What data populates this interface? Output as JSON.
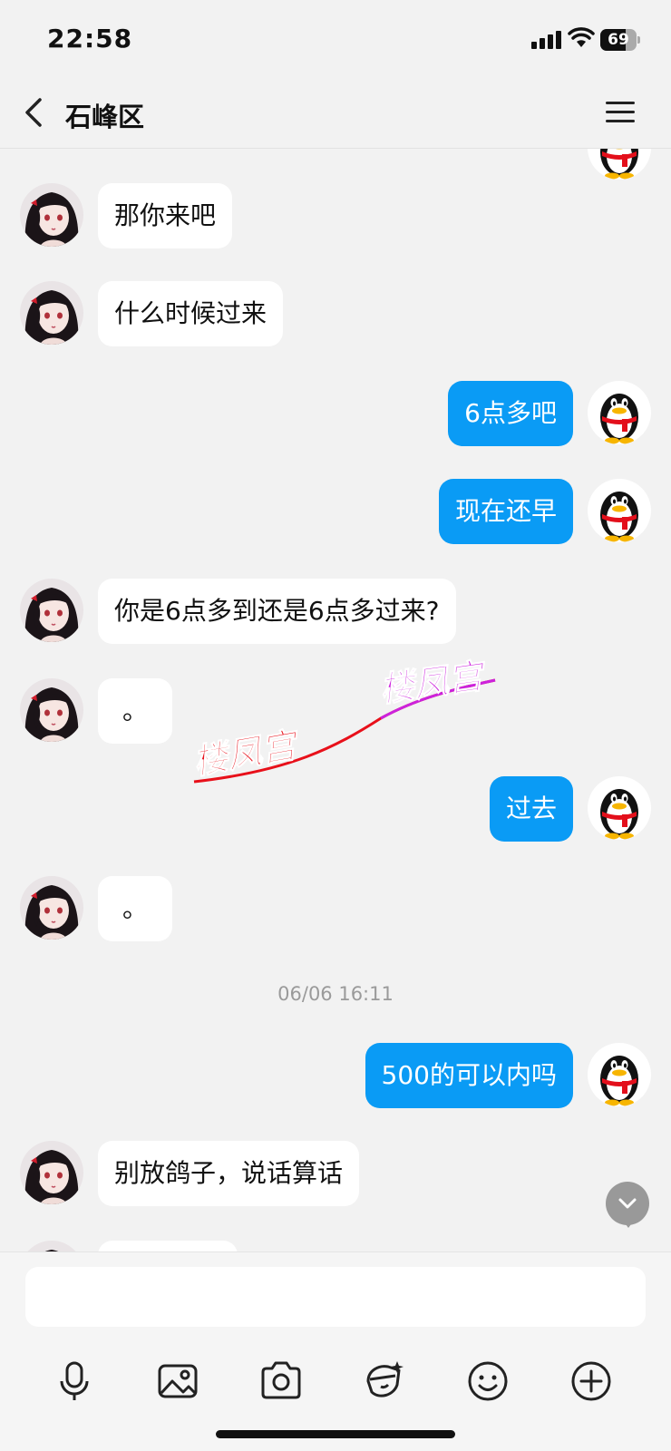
{
  "status": {
    "time": "22:58",
    "battery": "69"
  },
  "nav": {
    "title": "石峰区"
  },
  "messages": [
    {
      "side": "in",
      "text": "那你来吧"
    },
    {
      "side": "in",
      "text": "什么时候过来"
    },
    {
      "side": "out",
      "text": "6点多吧"
    },
    {
      "side": "out",
      "text": "现在还早"
    },
    {
      "side": "in",
      "text": "你是6点多到还是6点多过来?"
    },
    {
      "side": "in",
      "text": "。"
    },
    {
      "side": "out",
      "text": "过去"
    },
    {
      "side": "in",
      "text": "。"
    },
    {
      "side": "out",
      "text": "500的可以内吗"
    },
    {
      "side": "in",
      "text": "别放鸽子，说话算话"
    }
  ],
  "timestamp": "06/06 16:11",
  "watermark": {
    "text_1": "楼凤宫",
    "text_2": "楼凤宫",
    "color_1": "#e8101a",
    "color_2": "#cc22dd"
  },
  "toolbar": {
    "icons": [
      "microphone-icon",
      "image-icon",
      "camera-icon",
      "red-packet-icon",
      "emoji-icon",
      "plus-icon"
    ]
  },
  "colors": {
    "outgoing_bubble": "#0a9bf5",
    "incoming_bubble": "#ffffff",
    "background": "#f2f2f2"
  }
}
